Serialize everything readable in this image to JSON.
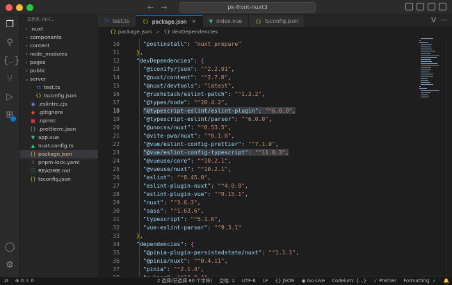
{
  "window": {
    "title": "pk-front-nuxt3"
  },
  "sidebar": {
    "header": "文件夹: PK-F...",
    "items": [
      {
        "label": ".nuxt",
        "kind": "folder",
        "expanded": false,
        "depth": 0
      },
      {
        "label": "components",
        "kind": "folder",
        "expanded": false,
        "depth": 0
      },
      {
        "label": "content",
        "kind": "folder",
        "expanded": false,
        "depth": 0
      },
      {
        "label": "node_modules",
        "kind": "folder",
        "expanded": false,
        "depth": 0
      },
      {
        "label": "pages",
        "kind": "folder",
        "expanded": false,
        "depth": 0
      },
      {
        "label": "public",
        "kind": "folder",
        "expanded": false,
        "depth": 0
      },
      {
        "label": "server",
        "kind": "folder",
        "expanded": true,
        "depth": 0
      },
      {
        "label": "test.ts",
        "kind": "ts",
        "depth": 1
      },
      {
        "label": "tsconfig.json",
        "kind": "json",
        "depth": 1
      },
      {
        "label": ".eslintrc.cjs",
        "kind": "eslint",
        "depth": 0
      },
      {
        "label": ".gitignore",
        "kind": "git",
        "depth": 0
      },
      {
        "label": ".npmrc",
        "kind": "npm",
        "depth": 0
      },
      {
        "label": ".prettierrc.json",
        "kind": "prettier",
        "depth": 0
      },
      {
        "label": "app.vue",
        "kind": "vue",
        "depth": 0
      },
      {
        "label": "nuxt.config.ts",
        "kind": "nuxt",
        "depth": 0
      },
      {
        "label": "package.json",
        "kind": "json",
        "depth": 0,
        "selected": true
      },
      {
        "label": "pnpm-lock.yaml",
        "kind": "yaml",
        "depth": 0
      },
      {
        "label": "README.md",
        "kind": "md",
        "depth": 0
      },
      {
        "label": "tsconfig.json",
        "kind": "json",
        "depth": 0
      }
    ]
  },
  "tabs": [
    {
      "label": "test.ts",
      "icon": "ts-file-icon",
      "active": false
    },
    {
      "label": "package.json",
      "icon": "json-file-icon",
      "active": true,
      "close": "×"
    },
    {
      "label": "index.vue",
      "icon": "vue-file-icon",
      "active": false
    },
    {
      "label": "tsconfig.json",
      "icon": "json-file-icon",
      "active": false
    }
  ],
  "breadcrumbs": {
    "file": "package.json",
    "separator": ">",
    "symbol": "{} devDependencies"
  },
  "editor": {
    "current_line": 18,
    "lines": [
      {
        "n": 10,
        "indent": 4,
        "key": "postinstall",
        "value": "nuxt prepare",
        "comma": false
      },
      {
        "n": 11,
        "indent": 2,
        "raw": "},"
      },
      {
        "n": 12,
        "indent": 2,
        "key": "devDependencies",
        "open": "{"
      },
      {
        "n": 13,
        "indent": 4,
        "key": "@iconify/json",
        "value": "^2.2.91",
        "comma": true
      },
      {
        "n": 14,
        "indent": 4,
        "key": "@nuxt/content",
        "value": "^2.7.0",
        "comma": true
      },
      {
        "n": 15,
        "indent": 4,
        "key": "@nuxt/devtools",
        "value": "latest",
        "comma": true
      },
      {
        "n": 16,
        "indent": 4,
        "key": "@rushstack/eslint-patch",
        "value": "^1.3.2",
        "comma": true
      },
      {
        "n": 17,
        "indent": 4,
        "key": "@types/node",
        "value": "^20.4.2",
        "comma": true
      },
      {
        "n": 18,
        "indent": 4,
        "key": "@typescript-eslint/eslint-plugin",
        "value": "^6.0.0",
        "comma": true,
        "highlight": true
      },
      {
        "n": 19,
        "indent": 4,
        "key": "@typescript-eslint/parser",
        "value": "^6.0.0",
        "comma": true
      },
      {
        "n": 20,
        "indent": 4,
        "key": "@unocss/nuxt",
        "value": "^0.53.5",
        "comma": true
      },
      {
        "n": 21,
        "indent": 4,
        "key": "@vite-pwa/nuxt",
        "value": "^0.1.0",
        "comma": true
      },
      {
        "n": 22,
        "indent": 4,
        "key": "@vue/eslint-config-prettier",
        "value": "^7.1.0",
        "comma": true
      },
      {
        "n": 23,
        "indent": 4,
        "key": "@vue/eslint-config-typescript",
        "value": "^11.0.3",
        "comma": true,
        "highlight": true
      },
      {
        "n": 24,
        "indent": 4,
        "key": "@vueuse/core",
        "value": "^10.2.1",
        "comma": true
      },
      {
        "n": 25,
        "indent": 4,
        "key": "@vueuse/nuxt",
        "value": "^10.2.1",
        "comma": true
      },
      {
        "n": 26,
        "indent": 4,
        "key": "eslint",
        "value": "^8.45.0",
        "comma": true
      },
      {
        "n": 27,
        "indent": 4,
        "key": "eslint-plugin-nuxt",
        "value": "^4.0.0",
        "comma": true
      },
      {
        "n": 28,
        "indent": 4,
        "key": "eslint-plugin-vue",
        "value": "^9.15.1",
        "comma": true
      },
      {
        "n": 29,
        "indent": 4,
        "key": "nuxt",
        "value": "^3.6.3",
        "comma": true
      },
      {
        "n": 30,
        "indent": 4,
        "key": "sass",
        "value": "^1.63.6",
        "comma": true
      },
      {
        "n": 31,
        "indent": 4,
        "key": "typescript",
        "value": "^5.1.6",
        "comma": true
      },
      {
        "n": 32,
        "indent": 4,
        "key": "vue-eslint-parser",
        "value": "^9.3.1",
        "comma": false
      },
      {
        "n": 33,
        "indent": 2,
        "raw": "},"
      },
      {
        "n": 34,
        "indent": 2,
        "key": "dependencies",
        "open": "{"
      },
      {
        "n": 35,
        "indent": 4,
        "key": "@pinia-plugin-persistedstate/nuxt",
        "value": "^1.1.1",
        "comma": true
      },
      {
        "n": 36,
        "indent": 4,
        "key": "@pinia/nuxt",
        "value": "^0.4.11",
        "comma": true
      },
      {
        "n": 37,
        "indent": 4,
        "key": "pinia",
        "value": "^2.1.4",
        "comma": true
      },
      {
        "n": 38,
        "indent": 4,
        "key": "swiper",
        "value": "^10.0.4",
        "comma": true
      }
    ]
  },
  "statusbar": {
    "errors": "0",
    "warnings": "0",
    "selection": "2 选择(已选择 80 个字符)",
    "spaces": "空格: 2",
    "encoding": "UTF-8",
    "eol": "LF",
    "language": "{} JSON",
    "golive": "Go Live",
    "codeium": "Codeium: {...}",
    "prettier": "Prettier",
    "formatting": "Formatting: ✓"
  },
  "colors": {
    "key": "#9cdcfe",
    "string": "#ce9178",
    "accent": "#0078d4",
    "active_file": "#e2c08d"
  }
}
